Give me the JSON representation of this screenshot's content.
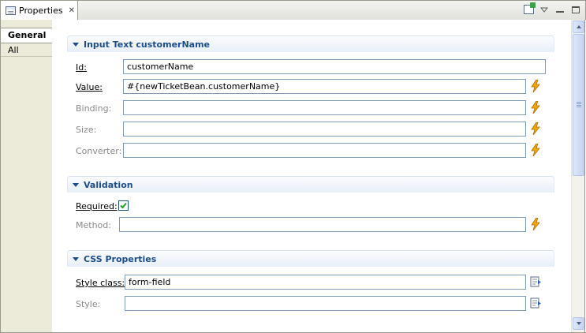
{
  "view": {
    "tab_title": "Properties",
    "close_glyph": "✕"
  },
  "toolbar": {
    "icons": [
      "pin-to-selection-icon",
      "view-menu-icon",
      "minimize-icon",
      "maximize-icon"
    ]
  },
  "nav": {
    "items": [
      {
        "label": "General",
        "selected": true
      },
      {
        "label": "All",
        "selected": false
      }
    ]
  },
  "sections": {
    "input_text": {
      "title": "Input Text customerName",
      "id_label": "Id:",
      "id_value": "customerName",
      "value_label": "Value:",
      "value_value": "#{newTicketBean.customerName}",
      "binding_label": "Binding:",
      "binding_value": "",
      "size_label": "Size:",
      "size_value": "",
      "converter_label": "Converter:",
      "converter_value": ""
    },
    "validation": {
      "title": "Validation",
      "required_label": "Required:",
      "required_checked": true,
      "method_label": "Method:",
      "method_value": ""
    },
    "css": {
      "title": "CSS Properties",
      "style_class_label": "Style class:",
      "style_class_value": "form-field",
      "style_label": "Style:",
      "style_value": ""
    }
  },
  "colors": {
    "section_title": "#1d4d8c",
    "bolt": "#f5a800",
    "field_border": "#7f9db9"
  }
}
